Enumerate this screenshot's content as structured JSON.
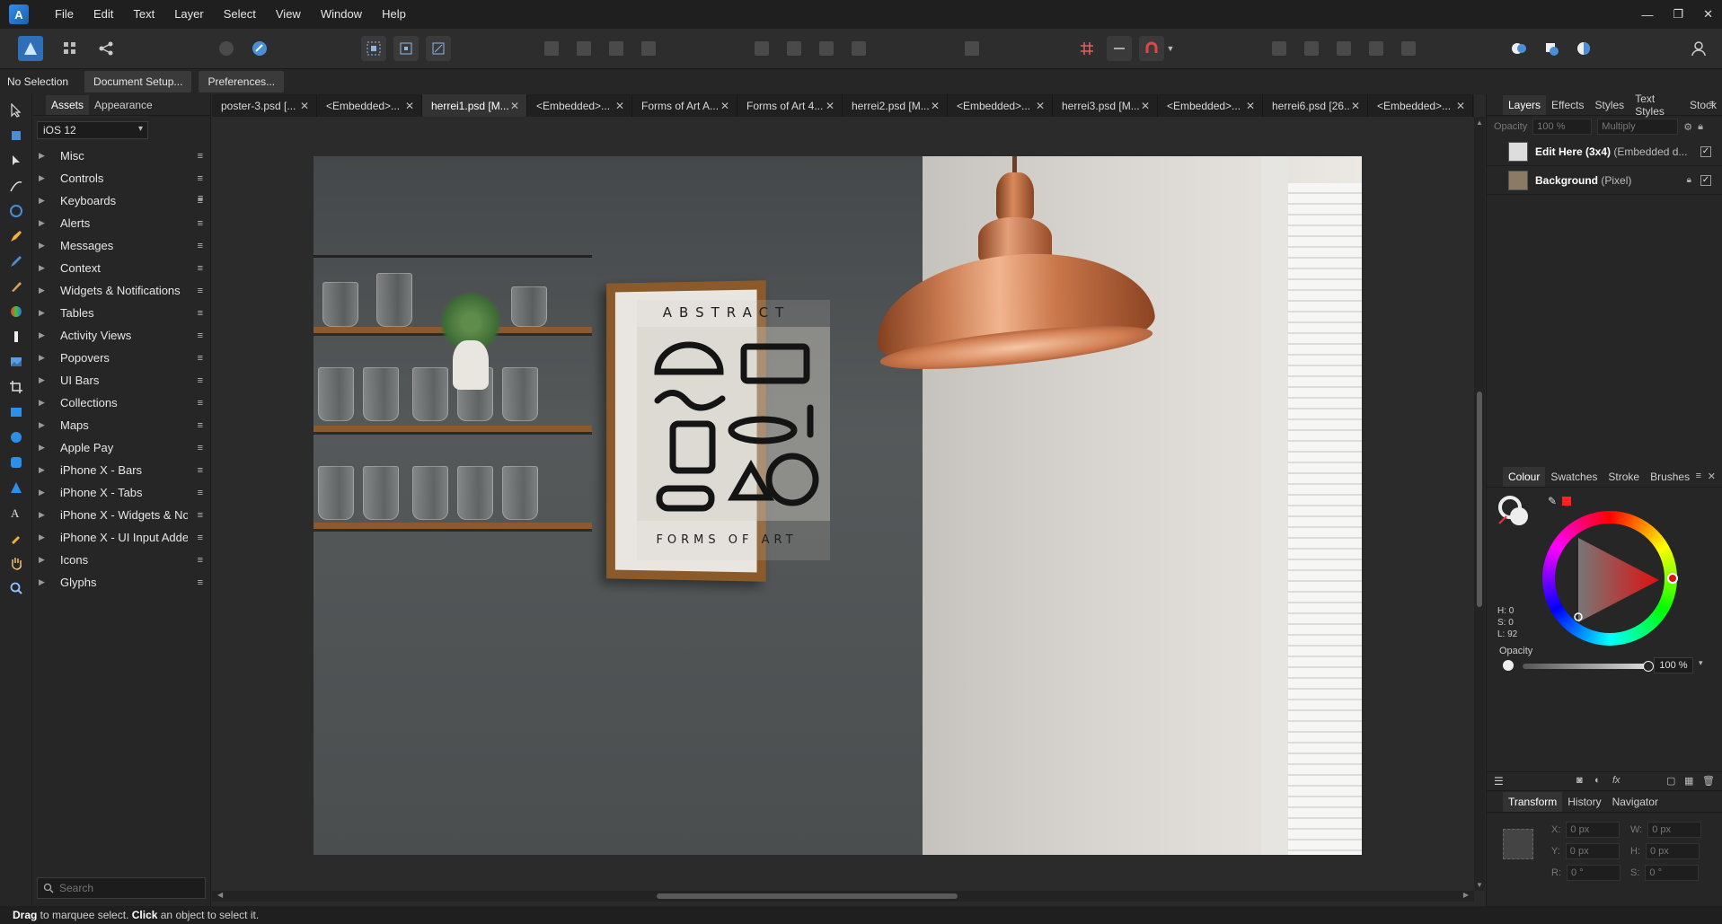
{
  "menu": [
    "File",
    "Edit",
    "Text",
    "Layer",
    "Select",
    "View",
    "Window",
    "Help"
  ],
  "app_icon": "affinity-designer-icon",
  "context_bar": {
    "selection": "No Selection",
    "document_setup": "Document Setup...",
    "preferences": "Preferences..."
  },
  "assets_panel": {
    "tabs": [
      "Assets",
      "Appearance"
    ],
    "category": "iOS 12",
    "items": [
      "Misc",
      "Controls",
      "Keyboards",
      "Alerts",
      "Messages",
      "Context",
      "Widgets & Notifications",
      "Tables",
      "Activity Views",
      "Popovers",
      "UI Bars",
      "Collections",
      "Maps",
      "Apple Pay",
      "iPhone X - Bars",
      "iPhone X - Tabs",
      "iPhone X - Widgets & Noti",
      "iPhone X - UI Input Addend",
      "Icons",
      "Glyphs"
    ],
    "search_placeholder": "Search"
  },
  "doc_tabs": [
    "poster-3.psd [...",
    "<Embedded>...",
    "herrei1.psd [M...",
    "<Embedded>...",
    "Forms of Art A...",
    "Forms of Art 4...",
    "herrei2.psd [M...",
    "<Embedded>...",
    "herrei3.psd [M...",
    "<Embedded>...",
    "herrei6.psd [26...",
    "<Embedded>..."
  ],
  "active_tab_index": 2,
  "poster": {
    "title": "ABSTRACT",
    "subtitle": "FORMS OF ART"
  },
  "layers_panel": {
    "tabs": [
      "Layers",
      "Effects",
      "Styles",
      "Text Styles",
      "Stock"
    ],
    "opacity_label": "Opacity",
    "opacity_value": "100 %",
    "blend_mode": "Multiply",
    "layers": [
      {
        "name": "Edit Here (3x4)",
        "detail": "(Embedded d..."
      },
      {
        "name": "Background",
        "detail": "(Pixel)"
      }
    ]
  },
  "colour_panel": {
    "tabs": [
      "Colour",
      "Swatches",
      "Stroke",
      "Brushes"
    ],
    "h": "H: 0",
    "s": "S: 0",
    "l": "L: 92",
    "opacity_label": "Opacity",
    "opacity_value": "100 %"
  },
  "transform_panel": {
    "tabs": [
      "Transform",
      "History",
      "Navigator"
    ],
    "x_label": "X:",
    "x": "0 px",
    "y_label": "Y:",
    "y": "0 px",
    "w_label": "W:",
    "w": "0 px",
    "h_label": "H:",
    "h": "0 px",
    "r_label": "R:",
    "r": "0 °",
    "s_label": "S:",
    "s": "0 °"
  },
  "status": {
    "drag": "Drag",
    "drag_text": " to marquee select. ",
    "click": "Click",
    "click_text": " an object to select it."
  },
  "colors": {
    "accent_blue": "#2f8fe6",
    "selected_red": "#ff2020"
  }
}
